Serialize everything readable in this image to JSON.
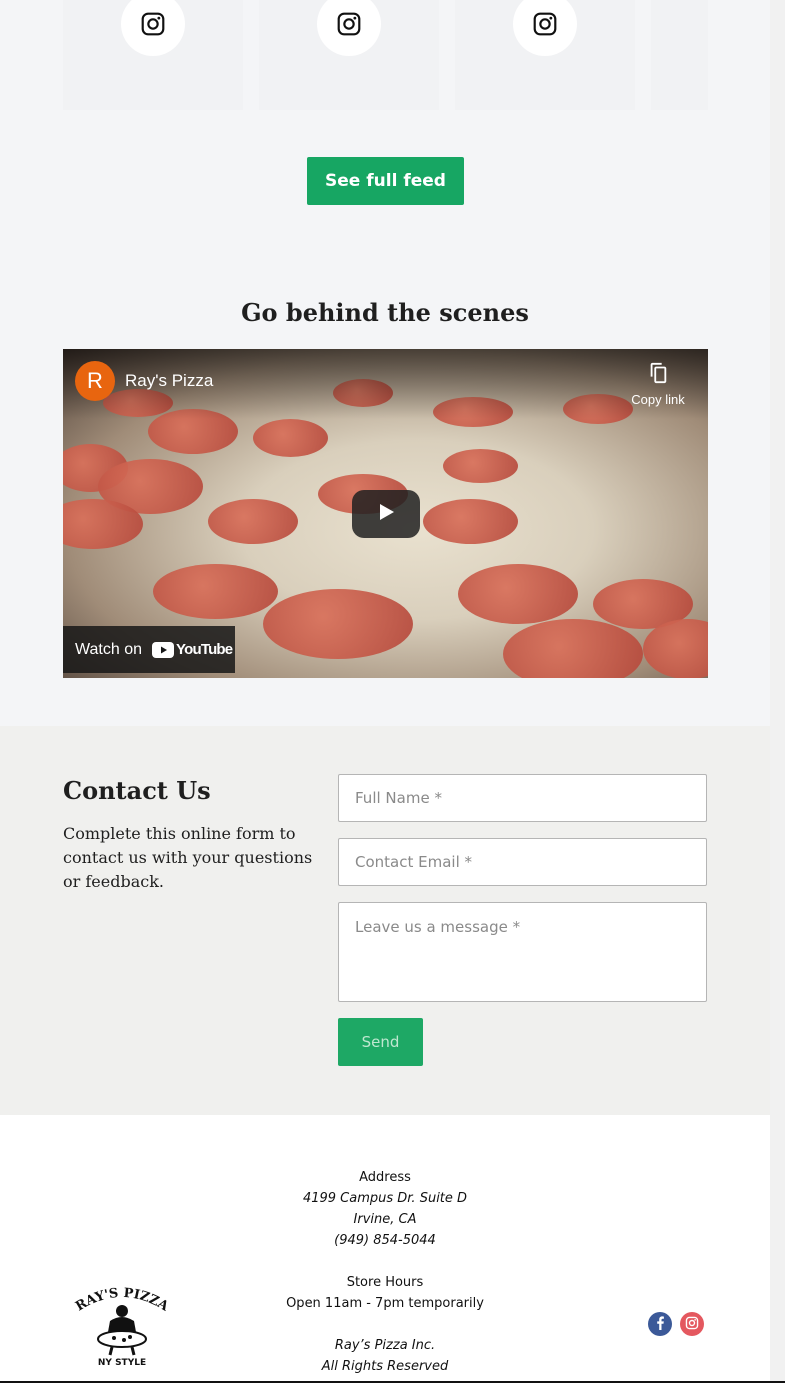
{
  "feed": {
    "tiles": [
      {
        "icon": "instagram-icon"
      },
      {
        "icon": "instagram-icon"
      },
      {
        "icon": "instagram-icon"
      },
      {
        "icon": ""
      }
    ],
    "see_full_feed_label": "See full feed"
  },
  "behind_scenes": {
    "title": "Go behind the scenes",
    "video": {
      "channel_initial": "R",
      "channel_name": "Ray's Pizza",
      "copy_link_label": "Copy link",
      "watch_on_label": "Watch on",
      "youtube_wordmark": "YouTube"
    }
  },
  "contact": {
    "title": "Contact Us",
    "description": "Complete this online form to contact us with your questions or feedback.",
    "full_name_placeholder": "Full Name *",
    "email_placeholder": "Contact Email *",
    "message_placeholder": "Leave us a message *",
    "send_label": "Send"
  },
  "footer": {
    "address_heading": "Address",
    "address_line1": "4199 Campus Dr. Suite D",
    "address_line2": "Irvine, CA",
    "phone": "(949) 854-5044",
    "hours_heading": "Store Hours",
    "hours_text": "Open 11am - 7pm temporarily",
    "company": "Ray’s Pizza Inc.",
    "rights": "All Rights Reserved",
    "logo_text_top": "RAY'S PIZZA",
    "logo_text_bottom": "NY STYLE",
    "social": [
      {
        "icon": "facebook-icon",
        "color": "#3b5998"
      },
      {
        "icon": "instagram-icon",
        "color": "#e4585f"
      }
    ]
  },
  "colors": {
    "accent_green": "#17a663",
    "youtube_red": "#ff0000",
    "avatar_orange": "#e8650f"
  }
}
